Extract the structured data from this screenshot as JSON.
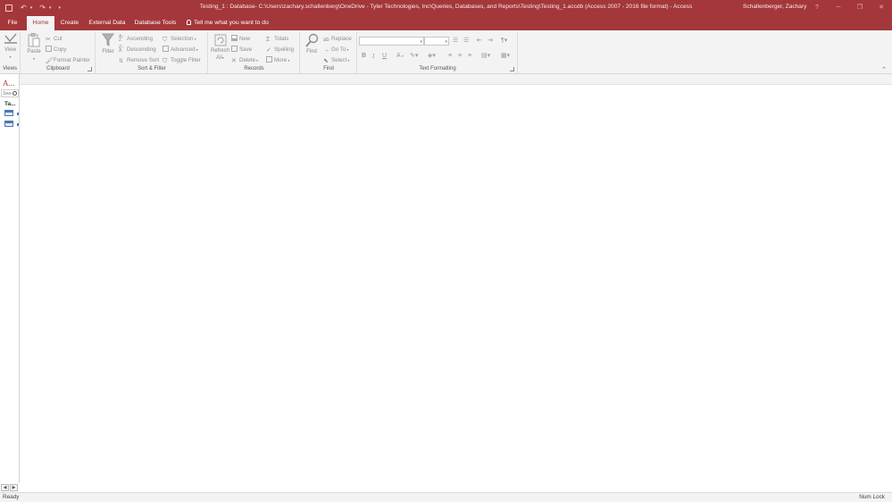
{
  "titlebar": {
    "title": "Testing_1 : Database- C:\\Users\\zachary.schallenberg\\OneDrive - Tyler Technologies, Inc\\Queries, Databases, and Reports\\Testing\\Testing_1.accdb (Access 2007 - 2016 file format)  -  Access",
    "user": "Schallenberger, Zachary",
    "help_glyph": "?",
    "qat_undo": "↶",
    "qat_redo": "↷",
    "qat_more": "▾",
    "ctl_minimize": "─",
    "ctl_restore": "❐",
    "ctl_close": "✕"
  },
  "tabs": [
    {
      "label": "File"
    },
    {
      "label": "Home"
    },
    {
      "label": "Create"
    },
    {
      "label": "External Data"
    },
    {
      "label": "Database Tools"
    }
  ],
  "tellme": "Tell me what you want to do",
  "ribbon": {
    "views": {
      "label": "Views",
      "view": "View"
    },
    "clipboard": {
      "label": "Clipboard",
      "paste": "Paste",
      "cut": "Cut",
      "copy": "Copy",
      "format_painter": "Format Painter"
    },
    "sortfilter": {
      "label": "Sort & Filter",
      "filter": "Filter",
      "ascending": "Ascending",
      "descending": "Descending",
      "remove_sort": "Remove Sort",
      "selection": "Selection",
      "advanced": "Advanced",
      "toggle_filter": "Toggle Filter"
    },
    "records": {
      "label": "Records",
      "refresh": "Refresh",
      "refresh_sub": "All",
      "new": "New",
      "save": "Save",
      "delete": "Delete",
      "totals": "Totals",
      "spelling": "Spelling",
      "more": "More"
    },
    "find": {
      "label": "Find",
      "find": "Find",
      "replace": "Replace",
      "goto": "Go To",
      "select": "Select"
    },
    "textformat": {
      "label": "Text Formatting",
      "bold": "B",
      "italic": "I",
      "underline": "U",
      "font_color": "A"
    }
  },
  "nav": {
    "header": "A...",
    "search_placeholder": "Sea",
    "group": "Ta...",
    "items": [
      {
        "name": "T"
      },
      {
        "name": "T"
      }
    ]
  },
  "status": {
    "left": "Ready",
    "right": "Num Lock"
  },
  "colors": {
    "accent": "#a4373a",
    "ribbon_bg": "#f3f3f3"
  }
}
